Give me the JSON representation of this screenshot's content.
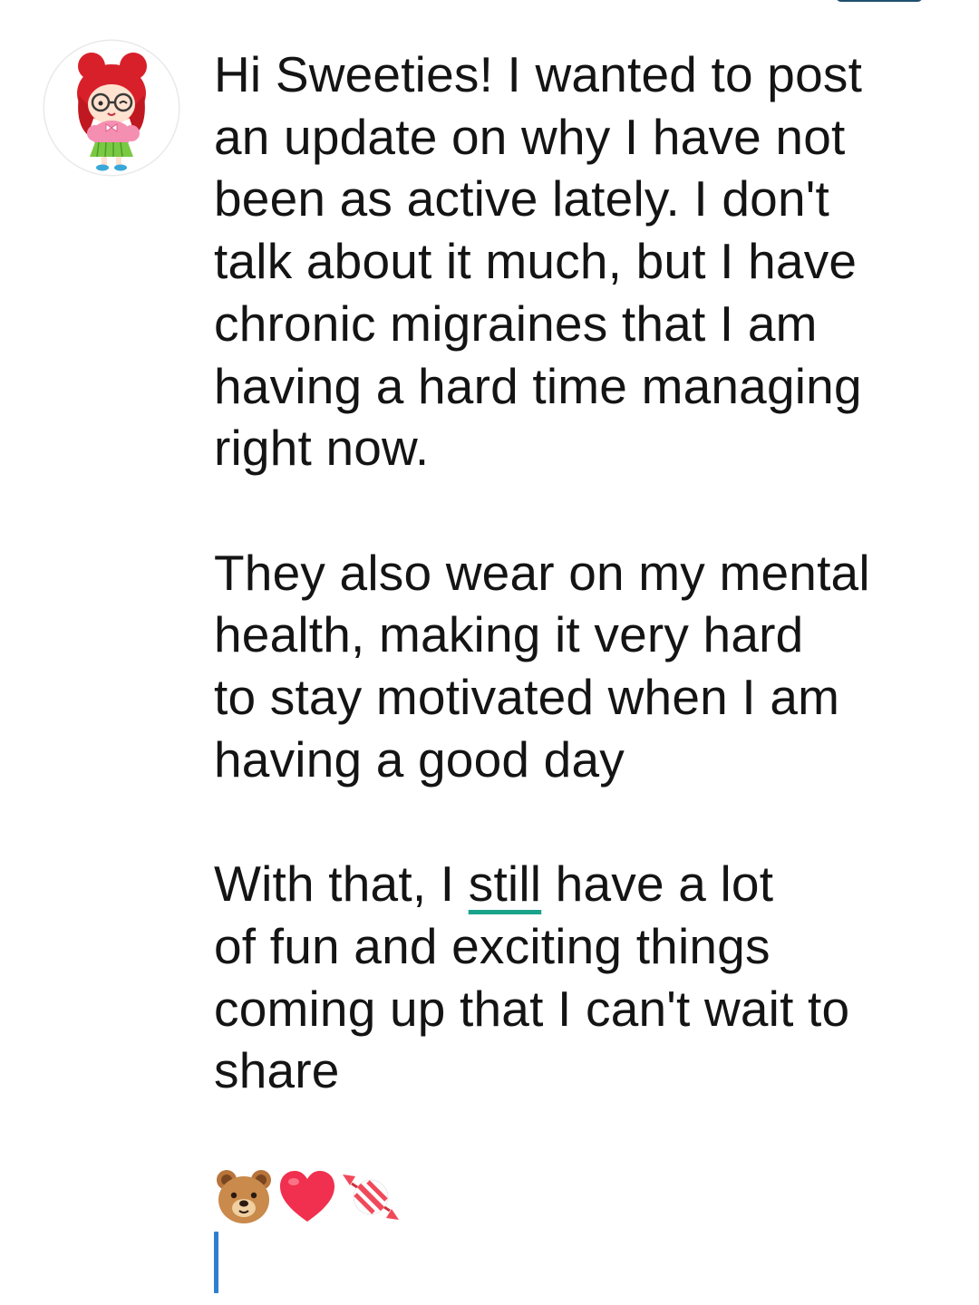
{
  "post": {
    "paragraph_1": "Hi Sweeties! I wanted to post\nan update on why I have not\nbeen as active lately. I don't\ntalk about it much, but I have\nchronic migraines that I am\nhaving a hard time managing\nright now.",
    "paragraph_2": "They also wear on my mental\nhealth, making it very hard\nto stay motivated when I am\nhaving a good day",
    "paragraph_3_before": "With that, I ",
    "paragraph_3_flagged": "still",
    "paragraph_3_after": " have a lot\nof fun and exciting things\ncoming up that I can't wait to\nshare",
    "emojis": [
      "bear-face-icon",
      "red-heart-icon",
      "candy-icon"
    ]
  },
  "colors": {
    "text": "#141414",
    "spellcheck_underline": "#1aa38b",
    "caret": "#2f7fd0",
    "avatar_hair": "#d8202a"
  }
}
